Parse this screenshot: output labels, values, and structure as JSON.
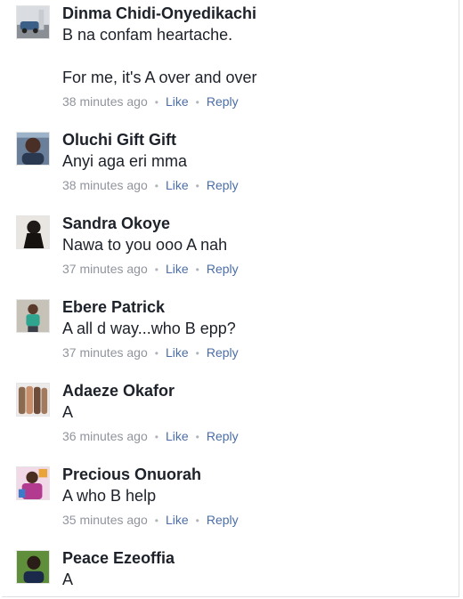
{
  "comments": [
    {
      "author": "Dinma Chidi-Onyedikachi",
      "text": "B na confam heartache.\n\nFor me, it's A over and over",
      "time": "38 minutes ago",
      "like": "Like",
      "reply": "Reply",
      "avatar": "avatar-photo-car"
    },
    {
      "author": "Oluchi Gift Gift",
      "text": "Anyi aga eri mma",
      "time": "38 minutes ago",
      "like": "Like",
      "reply": "Reply",
      "avatar": "avatar-photo-portrait"
    },
    {
      "author": "Sandra Okoye",
      "text": "Nawa to you ooo A nah",
      "time": "37 minutes ago",
      "like": "Like",
      "reply": "Reply",
      "avatar": "avatar-photo-dark"
    },
    {
      "author": "Ebere Patrick",
      "text": "A all d way...who B epp?",
      "time": "37 minutes ago",
      "like": "Like",
      "reply": "Reply",
      "avatar": "avatar-photo-green"
    },
    {
      "author": "Adaeze Okafor",
      "text": "A",
      "time": "36 minutes ago",
      "like": "Like",
      "reply": "Reply",
      "avatar": "avatar-photo-group"
    },
    {
      "author": "Precious Onuorah",
      "text": "A who B help",
      "time": "35 minutes ago",
      "like": "Like",
      "reply": "Reply",
      "avatar": "avatar-photo-colorful"
    },
    {
      "author": "Peace Ezeoffia",
      "text": "A",
      "avatar": "avatar-photo-green-portrait"
    }
  ],
  "separator": "•"
}
